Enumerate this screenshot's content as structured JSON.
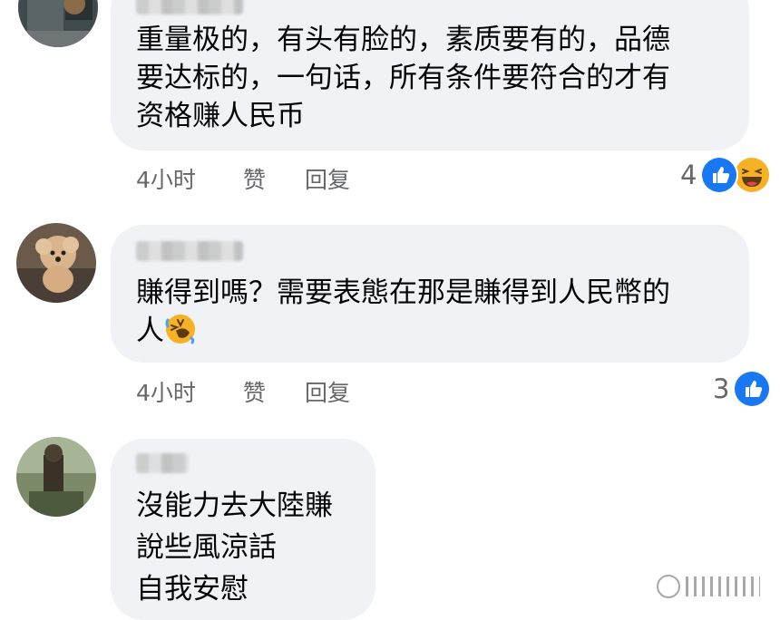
{
  "comments": [
    {
      "text_lines": [
        "重量极的，有头有脸的，素质要有的，品德",
        "要达标的，一句话，所有条件要符合的才有",
        "资格赚人民币"
      ],
      "time": "4小时",
      "like_label": "赞",
      "reply_label": "回复",
      "reaction_count": "4",
      "reactions": [
        "like-icon",
        "haha-icon"
      ]
    },
    {
      "text_lines": [
        "賺得到嗎？需要表態在那是賺得到人民幣的",
        "人"
      ],
      "text_emoji": "rolling-laughing-emoji",
      "time": "4小时",
      "like_label": "赞",
      "reply_label": "回复",
      "reaction_count": "3",
      "reactions": [
        "like-icon"
      ]
    },
    {
      "text_lines": [
        "沒能力去大陸賺",
        "說些風涼話",
        "自我安慰"
      ]
    }
  ],
  "colors": {
    "bubble": "#f0f2f5",
    "meta_text": "#65676b",
    "like_blue": "#1877f2",
    "haha_yellow": "#f7b125"
  }
}
